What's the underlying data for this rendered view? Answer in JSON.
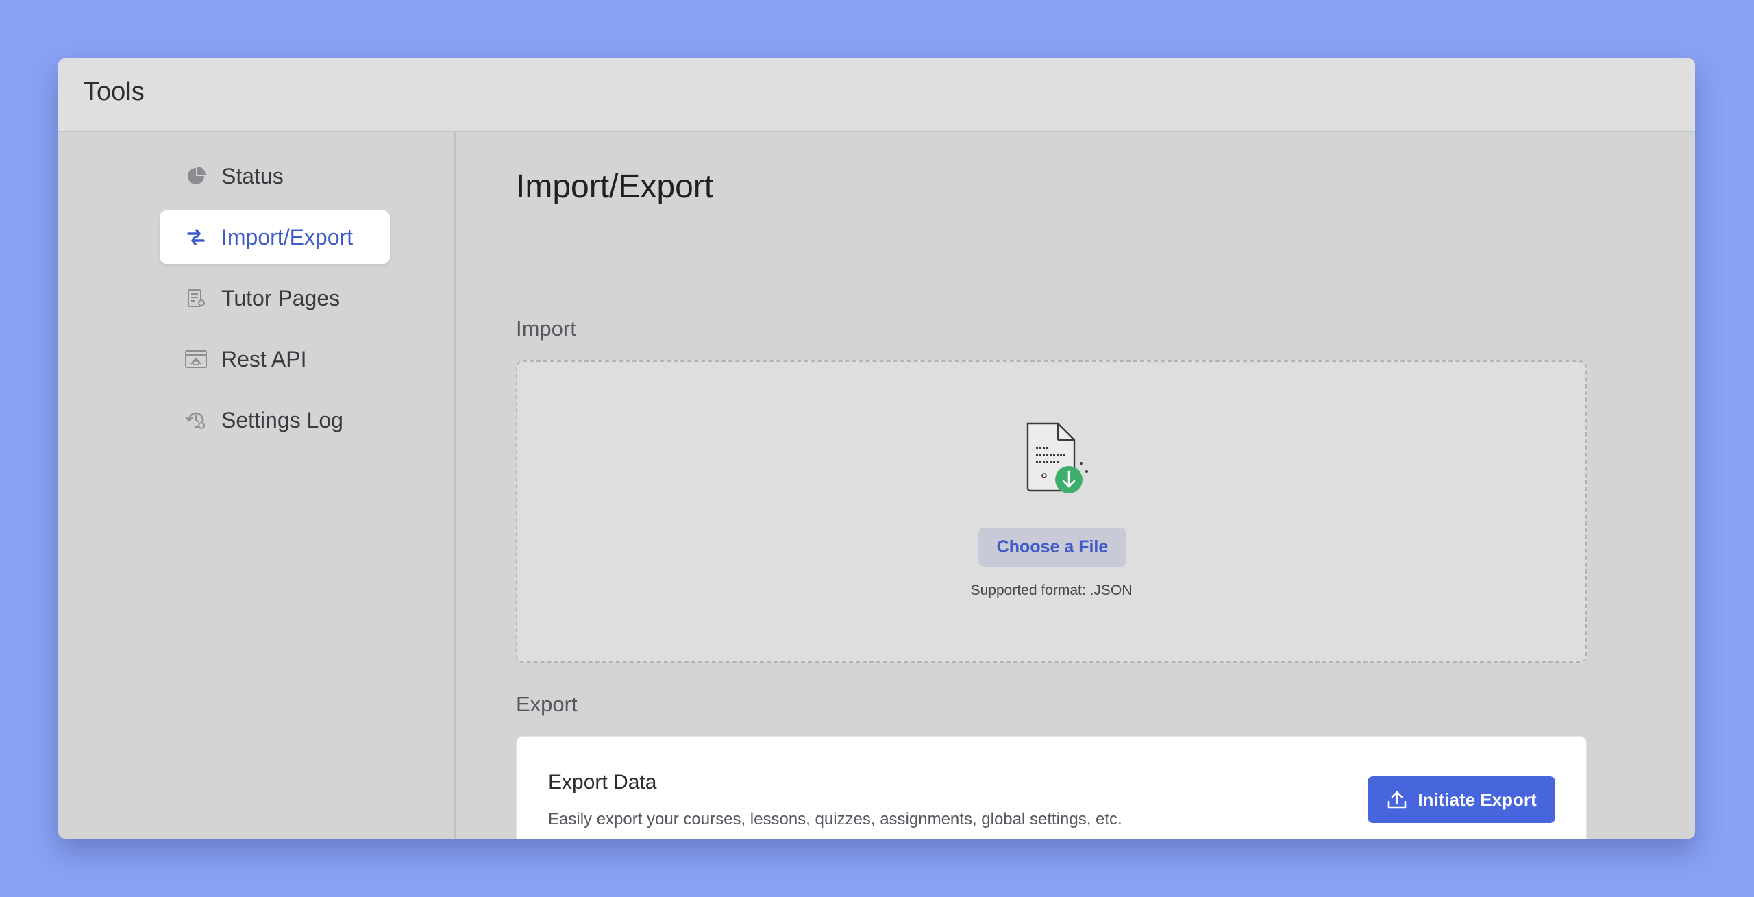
{
  "app": {
    "title": "Tools"
  },
  "sidebar": {
    "items": [
      {
        "label": "Status",
        "icon": "pie-chart-icon",
        "active": false
      },
      {
        "label": "Import/Export",
        "icon": "swap-arrows-icon",
        "active": true
      },
      {
        "label": "Tutor Pages",
        "icon": "document-settings-icon",
        "active": false
      },
      {
        "label": "Rest API",
        "icon": "api-window-icon",
        "active": false
      },
      {
        "label": "Settings Log",
        "icon": "history-gear-icon",
        "active": false
      }
    ]
  },
  "main": {
    "title": "Import/Export",
    "import": {
      "label": "Import",
      "choose_button": "Choose a File",
      "supported_format": "Supported format: .JSON",
      "illustration_icon": "file-download-icon"
    },
    "export": {
      "label": "Export",
      "card_title": "Export Data",
      "card_description": "Easily export your courses, lessons, quizzes, assignments, global settings, etc.",
      "button_label": "Initiate Export",
      "button_icon": "upload-icon"
    }
  },
  "colors": {
    "background": "#8aa2f4",
    "accent": "#4766de",
    "active_text": "#3f5bc8",
    "success": "#3fae6a"
  }
}
